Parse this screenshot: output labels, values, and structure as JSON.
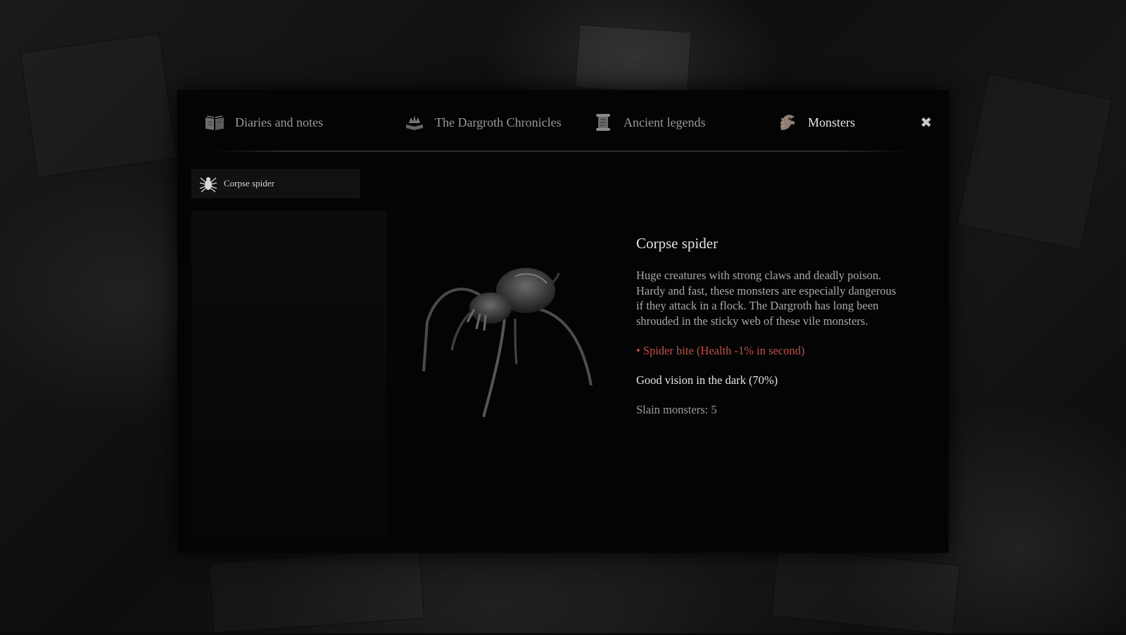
{
  "tabs": [
    {
      "label": "Diaries and notes",
      "icon": "open-book-icon",
      "active": false
    },
    {
      "label": "The Dargroth Chronicles",
      "icon": "book-crown-icon",
      "active": false
    },
    {
      "label": "Ancient legends",
      "icon": "scroll-icon",
      "active": false
    },
    {
      "label": "Monsters",
      "icon": "monster-icon",
      "active": true
    }
  ],
  "close": {
    "icon": "close-icon"
  },
  "list": {
    "items": [
      {
        "label": "Corpse spider",
        "icon": "spider-icon",
        "selected": true
      }
    ]
  },
  "detail": {
    "title": "Corpse spider",
    "description": "Huge creatures with strong claws and deadly poison. Hardy and fast, these monsters are especially dangerous if they attack in a flock. The Dargroth has long been shrouded in the sticky web of these vile monsters.",
    "effect_bullet": "•",
    "effect": "Spider bite (Health -1% in second)",
    "ability": "Good vision in the dark (70%)",
    "slain": "Slain monsters: 5"
  },
  "colors": {
    "effect": "#c0504a",
    "active_tab": "#e6e6e6",
    "inactive_tab": "#9a9a9a",
    "panel": "#040404"
  }
}
